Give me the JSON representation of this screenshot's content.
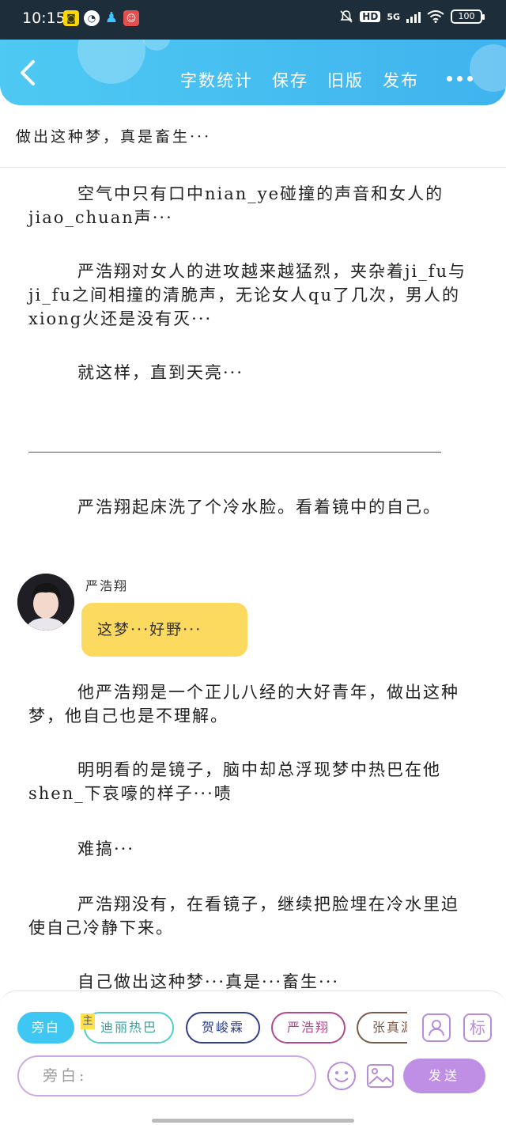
{
  "status_bar": {
    "time": "10:15",
    "signal_label": "5G",
    "hd_label": "HD",
    "battery": "100"
  },
  "header": {
    "actions": [
      "字数统计",
      "保存",
      "旧版",
      "发布"
    ],
    "accent_color": "#4ec9f3"
  },
  "title": "做出这种梦，真是畜生···",
  "paragraphs": {
    "p1": "空气中只有口中nian_ye碰撞的声音和女人的jiao_chuan声···",
    "p2": "严浩翔对女人的进攻越来越猛烈，夹杂着ji_fu与ji_fu之间相撞的清脆声，无论女人qu了几次，男人的xiong火还是没有灭···",
    "p3": "就这样，直到天亮···",
    "p4": "严浩翔起床洗了个冷水脸。看着镜中的自己。",
    "p5": "他严浩翔是一个正儿八经的大好青年，做出这种梦，他自己也是不理解。",
    "p6": "明明看的是镜子，脑中却总浮现梦中热巴在他shen_下哀嚎的样子···啧",
    "p7": "难搞···",
    "p8": "严浩翔没有，在看镜子，继续把脸埋在冷水里迫使自己冷静下来。",
    "p9": "自己做出这种梦···真是···畜生···"
  },
  "dialogue": {
    "speaker": "严浩翔",
    "text": "这梦···好野···",
    "bubble_color": "#fcd95f"
  },
  "composer": {
    "role_chips": [
      "旁白",
      "迪丽热巴",
      "贺峻霖",
      "严浩翔",
      "张真源"
    ],
    "main_tag": "主",
    "mark_button": "标",
    "input_placeholder": "旁白:",
    "send_label": "发送",
    "send_color": "#bf8fe6"
  }
}
